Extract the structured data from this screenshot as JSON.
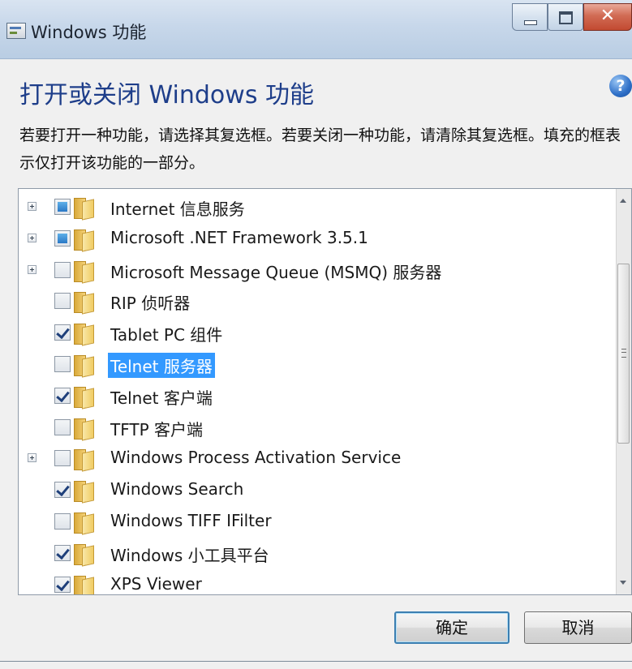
{
  "window": {
    "title": "Windows 功能"
  },
  "header": {
    "heading": "打开或关闭 Windows 功能",
    "help_icon": "help-icon",
    "description": "若要打开一种功能，请选择其复选框。若要关闭一种功能，请清除其复选框。填充的框表示仅打开该功能的一部分。"
  },
  "features": [
    {
      "label": "Internet 信息服务",
      "state": "partial",
      "expandable": true
    },
    {
      "label": "Microsoft .NET Framework 3.5.1",
      "state": "partial",
      "expandable": true
    },
    {
      "label": "Microsoft Message Queue (MSMQ) 服务器",
      "state": "unchecked",
      "expandable": true
    },
    {
      "label": "RIP 侦听器",
      "state": "unchecked",
      "expandable": false
    },
    {
      "label": "Tablet PC 组件",
      "state": "checked",
      "expandable": false
    },
    {
      "label": "Telnet 服务器",
      "state": "unchecked",
      "expandable": false,
      "selected": true
    },
    {
      "label": "Telnet 客户端",
      "state": "checked",
      "expandable": false
    },
    {
      "label": "TFTP 客户端",
      "state": "unchecked",
      "expandable": false
    },
    {
      "label": "Windows Process Activation Service",
      "state": "unchecked",
      "expandable": true
    },
    {
      "label": "Windows Search",
      "state": "checked",
      "expandable": false
    },
    {
      "label": "Windows TIFF IFilter",
      "state": "unchecked",
      "expandable": false
    },
    {
      "label": "Windows 小工具平台",
      "state": "checked",
      "expandable": false
    },
    {
      "label": "XPS Viewer",
      "state": "checked",
      "expandable": false
    }
  ],
  "buttons": {
    "ok": "确定",
    "cancel": "取消"
  },
  "colors": {
    "heading": "#1e3e8a",
    "selection": "#3399ff"
  }
}
